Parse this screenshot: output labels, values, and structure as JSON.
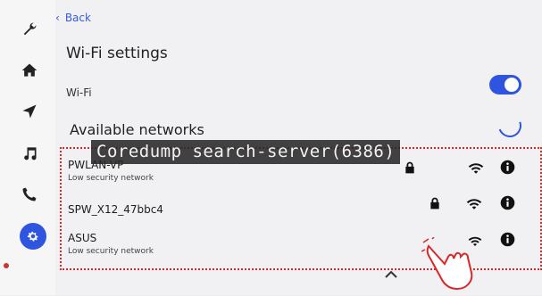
{
  "status_bar": {
    "items": [
      "▲",
      "⊥",
      "≡",
      "✱",
      "◣",
      "⌖"
    ]
  },
  "rail": {
    "items": [
      {
        "icon": "wrench-icon"
      },
      {
        "icon": "home-icon"
      },
      {
        "icon": "navigation-icon"
      },
      {
        "icon": "music-icon"
      },
      {
        "icon": "phone-icon"
      },
      {
        "icon": "settings-gear-icon",
        "active": true
      }
    ],
    "accent": "#2f54e0"
  },
  "header": {
    "back_label": "Back",
    "title": "Wi-Fi settings"
  },
  "wifi": {
    "label": "Wi-Fi",
    "enabled": true
  },
  "available": {
    "heading": "Available networks"
  },
  "overlay": {
    "banner_text": "Coredump search-server(6386)"
  },
  "networks": [
    {
      "name": "PWLAN-VP",
      "subtitle": "Low security network",
      "locked": true
    },
    {
      "name": "SPW_X12_47bbc4",
      "subtitle": "",
      "locked": true
    },
    {
      "name": "ASUS",
      "subtitle": "Low security network",
      "locked": false
    }
  ]
}
